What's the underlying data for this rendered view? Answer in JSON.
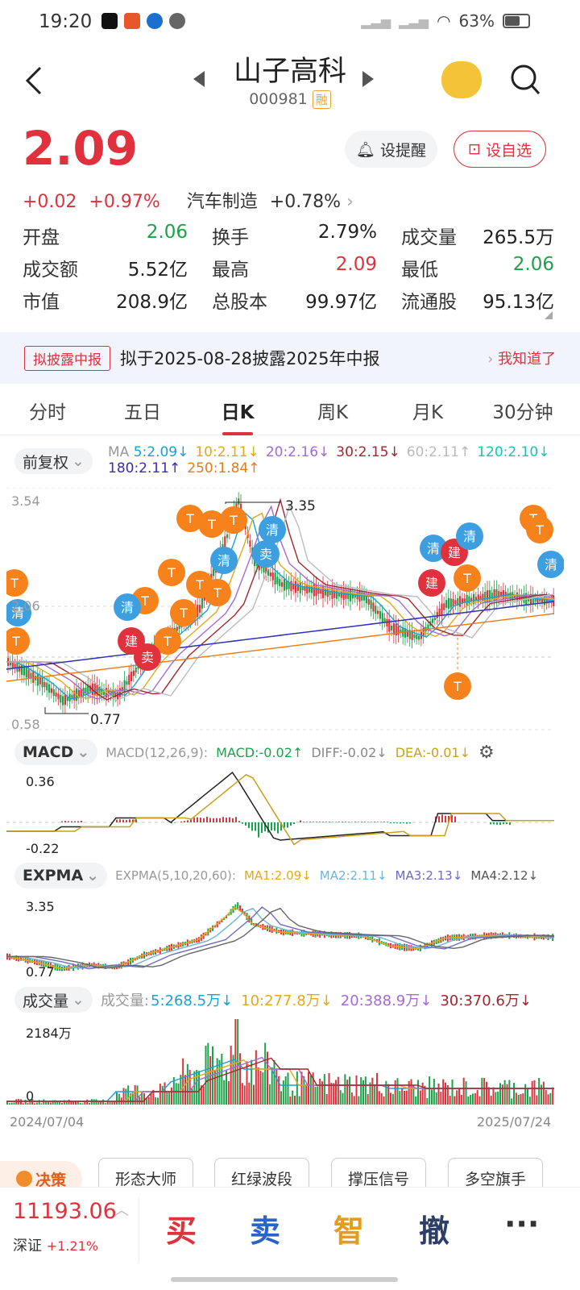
{
  "status": {
    "time": "19:20",
    "battery": "63%"
  },
  "header": {
    "title": "山子高科",
    "code": "000981",
    "rong": "融"
  },
  "price": {
    "last": "2.09",
    "change": "+0.02",
    "pct": "+0.97%",
    "sector": "汽车制造",
    "sector_pct": "+0.78%"
  },
  "buttons": {
    "alert": "设提醒",
    "fav": "设自选"
  },
  "stats": [
    [
      {
        "k": "开盘",
        "v": "2.06",
        "c": "#1aa34a"
      },
      {
        "k": "换手",
        "v": "2.79%",
        "c": "#222"
      },
      {
        "k": "成交量",
        "v": "265.5万",
        "c": "#222"
      }
    ],
    [
      {
        "k": "成交额",
        "v": "5.52亿",
        "c": "#222"
      },
      {
        "k": "最高",
        "v": "2.09",
        "c": "#e0323c"
      },
      {
        "k": "最低",
        "v": "2.06",
        "c": "#1aa34a"
      }
    ],
    [
      {
        "k": "市值",
        "v": "208.9亿",
        "c": "#222"
      },
      {
        "k": "总股本",
        "v": "99.97亿",
        "c": "#222"
      },
      {
        "k": "流通股",
        "v": "95.13亿",
        "c": "#222"
      }
    ]
  ],
  "notice": {
    "tag": "拟披露中报",
    "text": "拟于2025-08-28披露2025年中报",
    "action": "我知道了"
  },
  "tabs": [
    "分时",
    "五日",
    "日K",
    "周K",
    "月K",
    "30分钟"
  ],
  "kline": {
    "adj": "前复权",
    "ma_label": "MA",
    "ma": [
      {
        "t": "5:2.09↓",
        "c": "#17a2d6"
      },
      {
        "t": "10:2.11↓",
        "c": "#e6a817"
      },
      {
        "t": "20:2.16↓",
        "c": "#a36ad8"
      },
      {
        "t": "30:2.15↓",
        "c": "#a3262e"
      },
      {
        "t": "60:2.11↑",
        "c": "#bbbbbb"
      },
      {
        "t": "120:2.10↓",
        "c": "#18c4b4"
      }
    ],
    "ma2": [
      {
        "t": "180:2.11↑",
        "c": "#3a2bb8"
      },
      {
        "t": "250:1.84↑",
        "c": "#e67b1a"
      }
    ],
    "ymax": "3.54",
    "ymid": "2.06",
    "ymin": "0.58",
    "high": "3.35",
    "low": "0.77"
  },
  "macd": {
    "name": "MACD",
    "params": "MACD(12,26,9):",
    "macd": "MACD:-0.02↑",
    "diff": "DIFF:-0.02↓",
    "dea": "DEA:-0.01↓",
    "ymax": "0.36",
    "ymin": "-0.22"
  },
  "expma": {
    "name": "EXPMA",
    "params": "EXPMA(5,10,20,60):",
    "ma1": "MA1:2.09↓",
    "ma2": "MA2:2.11↓",
    "ma3": "MA3:2.13↓",
    "ma4": "MA4:2.12↓",
    "ymax": "3.35",
    "ymin": "0.77"
  },
  "volume": {
    "name": "成交量",
    "label": "成交量:",
    "v5": "5:268.5万↓",
    "v10": "10:277.8万↓",
    "v20": "20:388.9万↓",
    "v30": "30:370.6万↓",
    "ymax": "2184万",
    "ymin": "0",
    "start": "2024/07/04",
    "end": "2025/07/24"
  },
  "tools": {
    "decision": "决策",
    "t1": "形态大师",
    "t2": "红绿波段",
    "t3": "撑压信号",
    "t4": "多空旗手"
  },
  "footer": {
    "index": "11193.06",
    "index_name": "深证",
    "index_pct": "+1.21%",
    "buy": "买",
    "sell": "卖",
    "smart": "智",
    "cancel": "撤",
    "more": "···"
  }
}
